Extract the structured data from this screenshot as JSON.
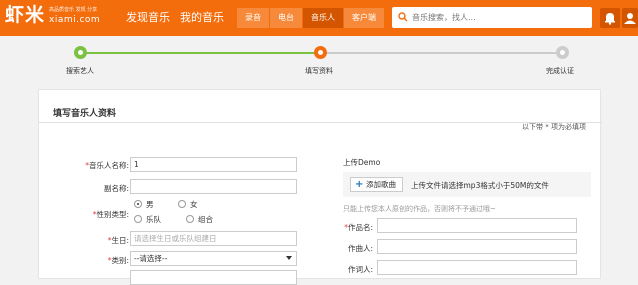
{
  "header": {
    "logo_text": "虾米",
    "logo_domain": "xiami.com",
    "logo_slogan": "高品质音乐 发现 分享",
    "nav": [
      "发现音乐",
      "我的音乐"
    ],
    "subnav": [
      "录音",
      "电台",
      "音乐人",
      "客户端"
    ],
    "active_subnav": "音乐人",
    "search_placeholder": "音乐搜索，找人...",
    "accent_color": "#f46d0d"
  },
  "steps": {
    "items": [
      {
        "label": "搜索艺人",
        "state": "done"
      },
      {
        "label": "填写资料",
        "state": "current"
      },
      {
        "label": "完成认证",
        "state": "todo"
      }
    ],
    "done_color": "#7bc142",
    "current_color": "#f46d0d",
    "todo_color": "#cccccc"
  },
  "form": {
    "title": "填写音乐人资料",
    "required_note": "以下带 * 项为必填项",
    "fields": {
      "artist_name_label": "音乐人名称:",
      "artist_name_value": "1",
      "alias_label": "副名称:",
      "gender_label": "性别类型:",
      "gender_options": [
        "男",
        "女",
        "乐队",
        "组合"
      ],
      "gender_selected": "男",
      "birthday_label": "生日:",
      "birthday_placeholder": "请选择生日或乐队组建日",
      "category_label": "类别:",
      "category_value": "--请选择--"
    },
    "upload": {
      "title": "上传Demo",
      "button_label": "添加歌曲",
      "tip": "上传文件请选择mp3格式小于50M的文件",
      "grey_tip": "只能上传您本人原创的作品，否则将不予通过哦~",
      "song_name_label": "作品名:",
      "composer_label": "作曲人:",
      "lyricist_label": "作词人:"
    }
  }
}
